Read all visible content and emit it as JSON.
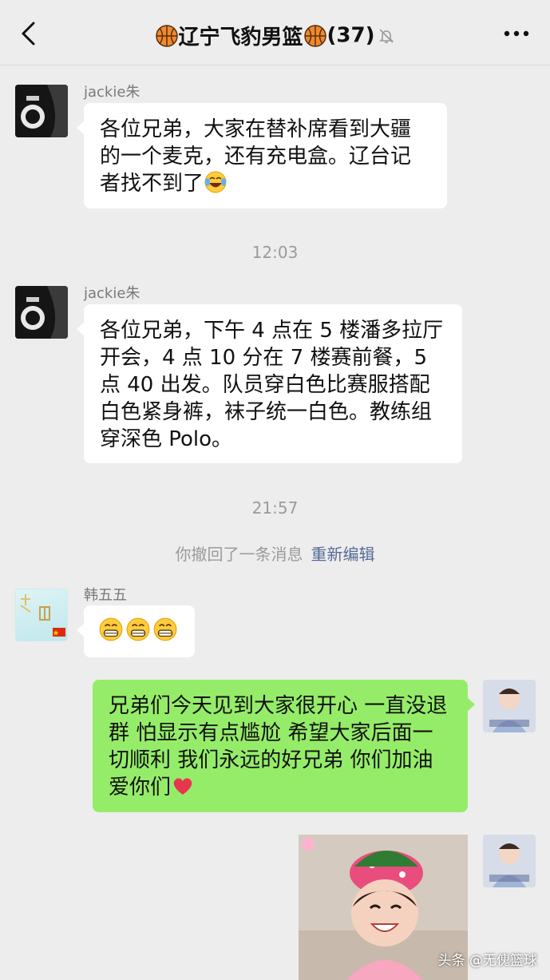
{
  "header": {
    "title": "辽宁飞豹男篮",
    "member_count": "(37)",
    "icons": [
      "back-icon",
      "basketball-icon",
      "mute-icon",
      "more-icon"
    ]
  },
  "messages": [
    {
      "sender": "jackie朱",
      "text": "各位兄弟，大家在替补席看到大疆的一个麦克，还有充电盒。辽台记者找不到了",
      "emoji": "laugh-cry"
    },
    {
      "sender": "jackie朱",
      "text": "各位兄弟，下午 4 点在 5 楼潘多拉厅开会，4 点 10 分在 7 楼赛前餐，5 点 40 出发。队员穿白色比赛服搭配白色紧身裤，袜子统一白色。教练组穿深色 Polo。"
    },
    {
      "sender": "韩五五",
      "emoji": "grin x3"
    },
    {
      "self": true,
      "text": "兄弟们今天见到大家很开心 一直没退群 怕显示有点尴尬 希望大家后面一切顺利 我们永远的好兄弟 你们加油 爱你们",
      "emoji": "red-heart"
    },
    {
      "self": true,
      "type": "image"
    }
  ],
  "timestamps": [
    "12:03",
    "21:57"
  ],
  "system": {
    "recalled": "你撤回了一条消息",
    "reedit": "重新编辑"
  },
  "watermark": "头条 @无傀篮球",
  "colors": {
    "background": "#ededed",
    "bubble_in": "#ffffff",
    "bubble_out": "#95ec69",
    "link": "#576b95"
  }
}
